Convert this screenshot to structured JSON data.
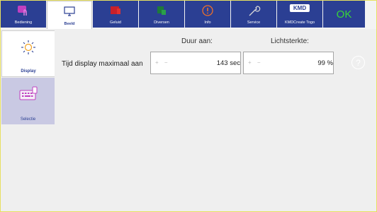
{
  "tabs": {
    "bediening": "Bediening",
    "beeld": "Beeld",
    "geluid": "Geluid",
    "diversen": "Diversen",
    "info": "Info",
    "service": "Service",
    "kmd_logo": "KMD",
    "kmd_create": "KMDCreate Togo",
    "ok": "OK"
  },
  "sidebar": {
    "display": "Display",
    "selectie": "Selectie"
  },
  "settings": {
    "col_duration": "Duur aan:",
    "col_brightness": "Lichtsterkte:",
    "row_label": "Tijd display maximaal aan",
    "duration_controls": "+ −",
    "duration_value": "143 sec",
    "brightness_controls": "+ −",
    "brightness_value": "99 %",
    "help": "?"
  },
  "colors": {
    "tab_blue": "#2b3f93",
    "ok_green": "#37d637",
    "selected_side": "#c9c9e3"
  }
}
